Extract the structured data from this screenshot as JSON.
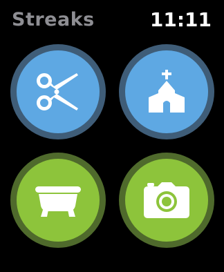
{
  "header": {
    "app_title": "Streaks",
    "time": "11:11"
  },
  "tasks": [
    {
      "icon": "scissors-icon",
      "fill": "#5ea8e3",
      "ring": "#3f5d78"
    },
    {
      "icon": "church-icon",
      "fill": "#5ea8e3",
      "ring": "#3f5d78"
    },
    {
      "icon": "bathtub-icon",
      "fill": "#8dc43b",
      "ring": "#4f6a2c"
    },
    {
      "icon": "camera-icon",
      "fill": "#8dc43b",
      "ring": "#4f6a2c"
    }
  ]
}
